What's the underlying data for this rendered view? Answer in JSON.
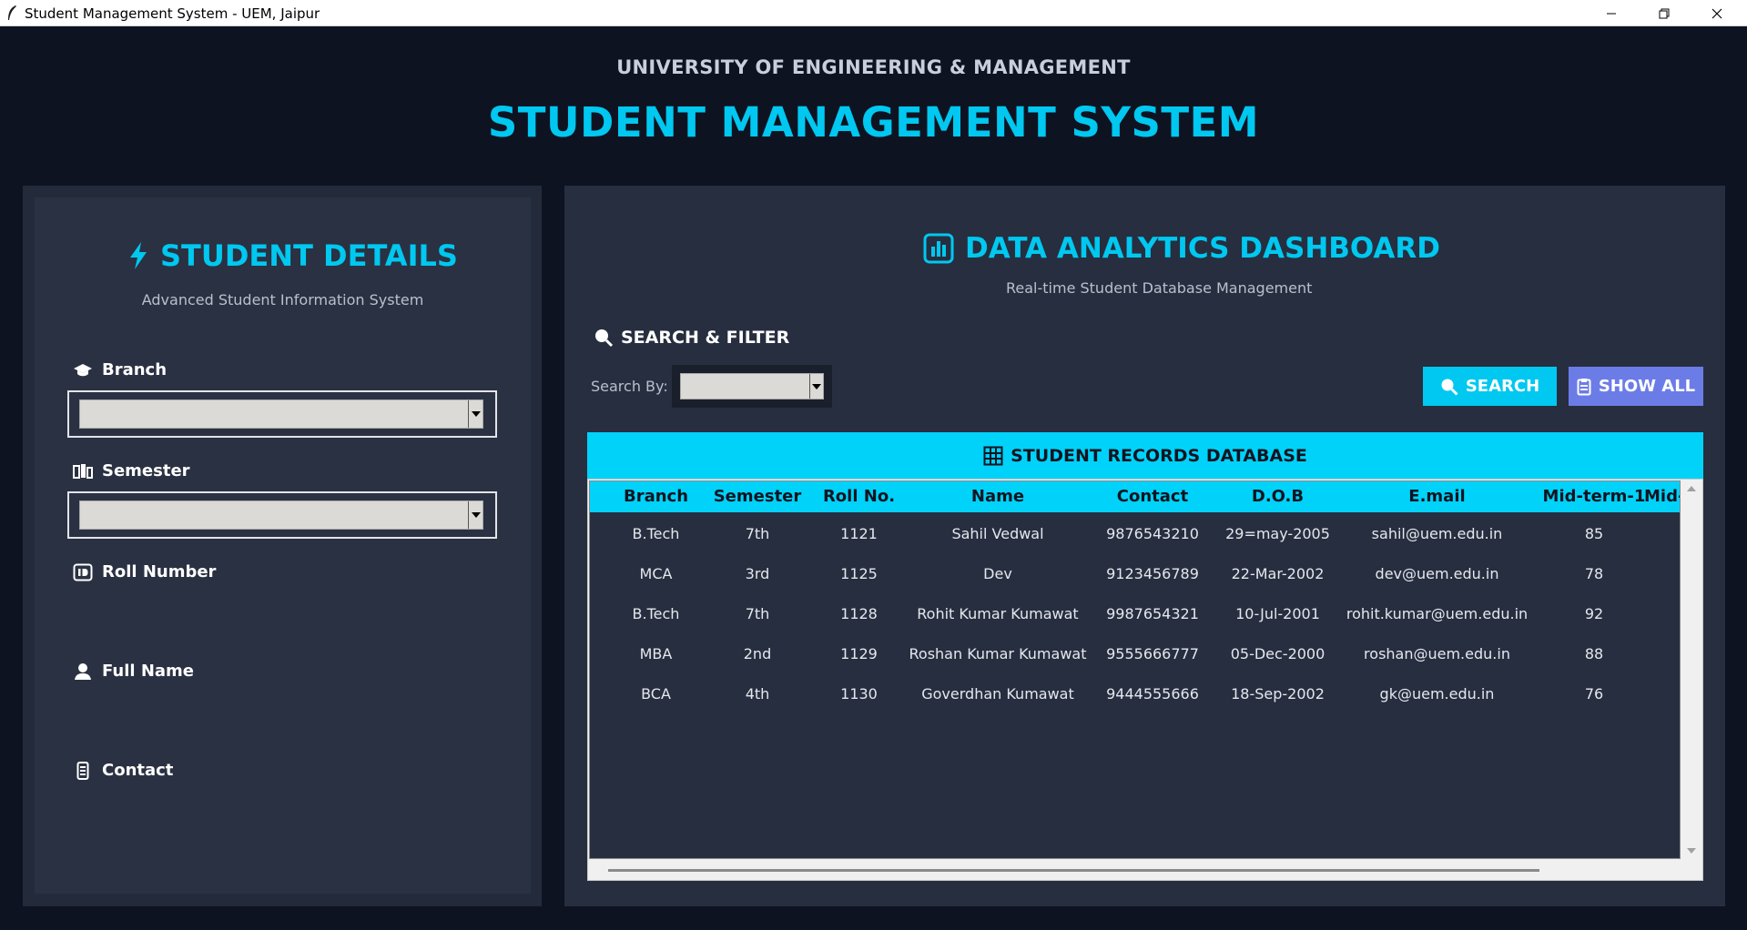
{
  "window": {
    "title": "Student Management System - UEM, Jaipur"
  },
  "header": {
    "university": "UNIVERSITY OF ENGINEERING & MANAGEMENT",
    "app_title": "STUDENT MANAGEMENT SYSTEM"
  },
  "student_panel": {
    "title": "STUDENT DETAILS",
    "subtitle": "Advanced Student Information System",
    "fields": {
      "branch": {
        "label": "Branch",
        "value": ""
      },
      "semester": {
        "label": "Semester",
        "value": ""
      },
      "roll_number": {
        "label": "Roll Number"
      },
      "full_name": {
        "label": "Full Name"
      },
      "contact": {
        "label": "Contact"
      }
    }
  },
  "dashboard": {
    "title": "DATA ANALYTICS DASHBOARD",
    "subtitle": "Real-time Student Database Management",
    "search_filter": {
      "title": "SEARCH & FILTER",
      "search_by_label": "Search By:",
      "search_by_value": "",
      "search_button": "SEARCH",
      "show_all_button": "SHOW ALL"
    },
    "records": {
      "title": "STUDENT RECORDS DATABASE",
      "columns": [
        "Branch",
        "Semester",
        "Roll No.",
        "Name",
        "Contact",
        "D.O.B",
        "E.mail",
        "Mid-term-1",
        "Mid-"
      ],
      "rows": [
        [
          "B.Tech",
          "7th",
          "1121",
          "Sahil Vedwal",
          "9876543210",
          "29=may-2005",
          "sahil@uem.edu.in",
          "85"
        ],
        [
          "MCA",
          "3rd",
          "1125",
          "Dev",
          "9123456789",
          "22-Mar-2002",
          "dev@uem.edu.in",
          "78"
        ],
        [
          "B.Tech",
          "7th",
          "1128",
          "Rohit Kumar Kumawat",
          "9987654321",
          "10-Jul-2001",
          "rohit.kumar@uem.edu.in",
          "92"
        ],
        [
          "MBA",
          "2nd",
          "1129",
          "Roshan Kumar Kumawat",
          "9555666777",
          "05-Dec-2000",
          "roshan@uem.edu.in",
          "88"
        ],
        [
          "BCA",
          "4th",
          "1130",
          "Goverdhan Kumawat",
          "9444555666",
          "18-Sep-2002",
          "gk@uem.edu.in",
          "76"
        ]
      ]
    }
  },
  "icons": {
    "title_bar": "feather-icon",
    "student_details": "lightning-icon",
    "branch": "graduation-cap-icon",
    "semester": "books-icon",
    "roll_number": "id-card-icon",
    "full_name": "person-icon",
    "contact": "phone-icon",
    "dashboard": "bar-chart-icon",
    "search": "magnifier-icon",
    "show_all": "clipboard-icon",
    "records": "grid-table-icon"
  },
  "colors": {
    "accent": "#00c8f0",
    "show_all_button": "#6c7ce7",
    "background": "#0e1322",
    "panel": "#272e3f"
  }
}
